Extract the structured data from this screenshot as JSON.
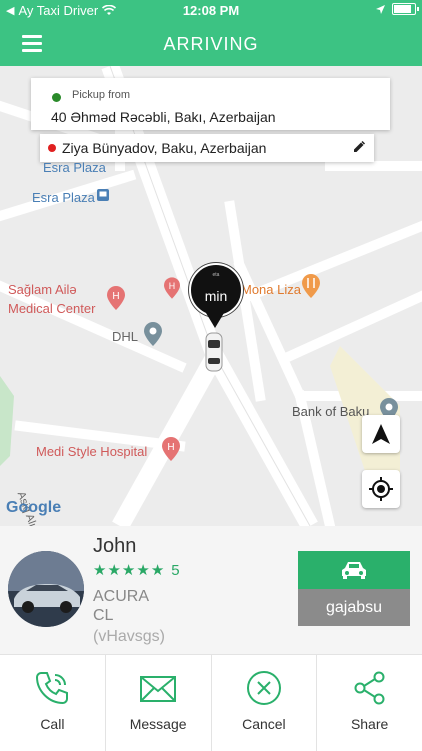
{
  "status_bar": {
    "carrier": "Ay Taxi Driver",
    "time": "12:08 PM"
  },
  "header": {
    "title": "ARRIVING"
  },
  "trip": {
    "pickup_label": "Pickup from",
    "pickup_address": "40 Əhməd Rəcəbli,  Bakı,  Azerbaijan",
    "dropoff_address": "Ziya Bünyadov,  Baku,  Azerbaijan"
  },
  "map": {
    "eta_small": "eta",
    "eta_unit": "min",
    "places": {
      "esra_plaza_top": "Esra Plaza",
      "esra_plaza": "Esra Plaza",
      "saglam_line1": "Sağlam Ailə",
      "saglam_line2": "Medical Center",
      "dhl": "DHL",
      "mona_liza": "Mona Liza",
      "bank_of_baku": "Bank of Baku",
      "medi_style": "Medi Style Hospital",
      "street": "Asiq Alı"
    },
    "attribution": "Google"
  },
  "driver": {
    "name": "John",
    "rating": "5",
    "car_make": "ACURA",
    "car_model": "CL",
    "car_id": "(vHavsgs)",
    "plate": "gajabsu"
  },
  "actions": [
    {
      "label": "Call",
      "icon": "phone-icon"
    },
    {
      "label": "Message",
      "icon": "envelope-icon"
    },
    {
      "label": "Cancel",
      "icon": "cancel-icon"
    },
    {
      "label": "Share",
      "icon": "share-icon"
    }
  ],
  "colors": {
    "brand": "#3cc383",
    "accent_dark": "#2ab06b",
    "plate_bg": "#8b8b8b",
    "pickup_dot": "#2a8a2a",
    "dropoff_dot": "#e02020"
  }
}
